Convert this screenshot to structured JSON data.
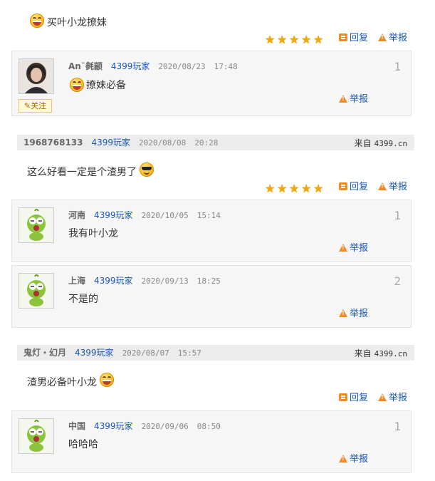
{
  "post_top": {
    "content": "买叶小龙撩妹",
    "actions": {
      "reply": "回复",
      "report": "举报"
    },
    "stars": 5
  },
  "reply_1": {
    "floor": "1",
    "user": "An˜毵颛",
    "source": "4399玩家",
    "date": "2020/08/23",
    "time": "17:48",
    "text": "撩妹必备",
    "follow": "关注",
    "report": "举报"
  },
  "post_2": {
    "user": "1968768133",
    "source": "4399玩家",
    "date": "2020/08/08",
    "time": "20:28",
    "from_label": "来自",
    "from_domain": "4399.cn",
    "content": "这么好看一定是个渣男了",
    "stars": 5,
    "actions": {
      "reply": "回复",
      "report": "举报"
    },
    "replies": [
      {
        "floor": "1",
        "user": "河南",
        "source": "4399玩家",
        "date": "2020/10/05",
        "time": "15:14",
        "text": "我有叶小龙",
        "report": "举报"
      },
      {
        "floor": "2",
        "user": "上海",
        "source": "4399玩家",
        "date": "2020/09/13",
        "time": "18:25",
        "text": "不是的",
        "report": "举报"
      }
    ]
  },
  "post_3": {
    "user": "鬼灯・幻月",
    "source": "4399玩家",
    "date": "2020/08/07",
    "time": "15:57",
    "from_label": "来自",
    "from_domain": "4399.cn",
    "content": "渣男必备叶小龙",
    "actions": {
      "reply": "回复",
      "report": "举报"
    },
    "replies": [
      {
        "floor": "1",
        "user": "中国",
        "source": "4399玩家",
        "date": "2020/09/06",
        "time": "08:50",
        "text": "哈哈哈",
        "report": "举报"
      }
    ]
  },
  "colors": {
    "link": "#1a57b3",
    "star": "#f5a700",
    "icon": "#f08a24"
  },
  "icons": [
    "grin-emoji-icon",
    "cool-emoji-icon",
    "star-icon",
    "reply-icon",
    "warning-icon",
    "frog-avatar"
  ]
}
